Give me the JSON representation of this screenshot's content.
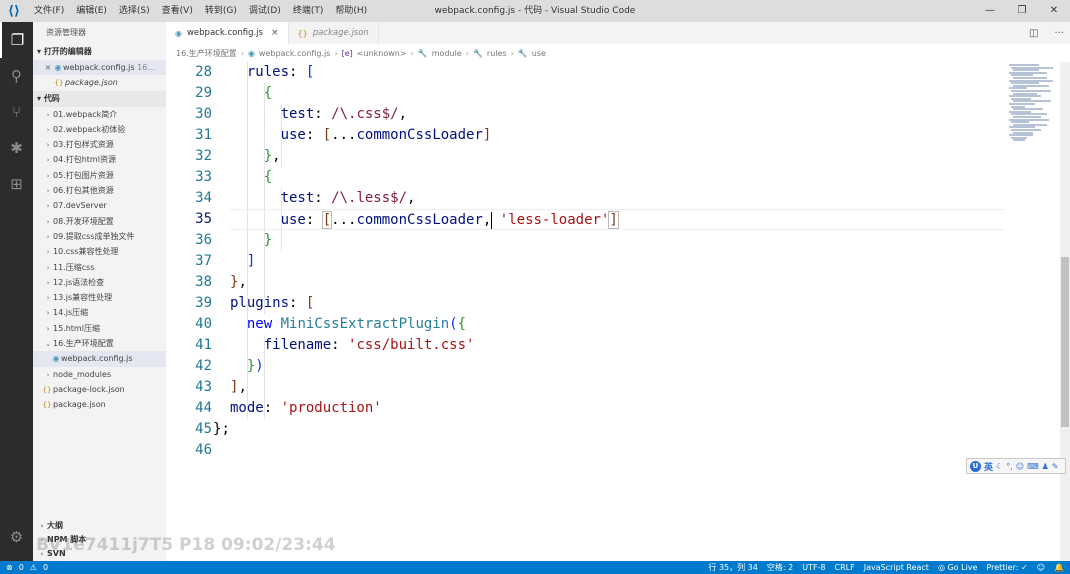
{
  "window": {
    "title": "webpack.config.js - 代码 - Visual Studio Code",
    "menu": [
      "文件(F)",
      "编辑(E)",
      "选择(S)",
      "查看(V)",
      "转到(G)",
      "调试(D)",
      "终端(T)",
      "帮助(H)"
    ]
  },
  "sidebar": {
    "title": "资源管理器",
    "open_editors_label": "打开的编辑器",
    "open_editors": [
      {
        "name": "webpack.config.js",
        "suffix": "16...",
        "icon": "js-icon",
        "selected": true
      },
      {
        "name": "package.json",
        "suffix": "",
        "icon": "json-icon",
        "selected": false
      }
    ],
    "folder_label": "代码",
    "folders": [
      "01.webpack简介",
      "02.webpack初体验",
      "03.打包样式资源",
      "04.打包html资源",
      "05.打包图片资源",
      "06.打包其他资源",
      "07.devServer",
      "08.开发环境配置",
      "09.提取css成单独文件",
      "10.css兼容性处理",
      "11.压缩css",
      "12.js语法检查",
      "13.js兼容性处理",
      "14.js压缩",
      "15.html压缩",
      "16.生产环境配置"
    ],
    "nested_file": "webpack.config.js",
    "root_files": [
      "node_modules",
      "package-lock.json",
      "package.json"
    ],
    "bottom_sections": [
      "大纲",
      "NPM 脚本",
      "SVN"
    ]
  },
  "tabs": [
    {
      "label": "webpack.config.js",
      "close": "×"
    },
    {
      "label": "package.json"
    }
  ],
  "breadcrumb": [
    "16.生产环境配置",
    "webpack.config.js",
    "<unknown>",
    "module",
    "rules",
    "use"
  ],
  "editor": {
    "line_numbers": [
      "28",
      "29",
      "30",
      "31",
      "32",
      "33",
      "34",
      "35",
      "36",
      "37",
      "38",
      "39",
      "40",
      "41",
      "42",
      "43",
      "44",
      "45",
      "46"
    ],
    "current_line": "35"
  },
  "ime": {
    "logo": "U",
    "lang": "英"
  },
  "watermark": "BV1e7411j7T5 P18 09:02/23:44",
  "status": {
    "errors": "0",
    "warnings": "0",
    "position": "行 35，列 34",
    "spaces": "空格: 2",
    "encoding": "UTF-8",
    "eol": "CRLF",
    "language": "JavaScript React",
    "golive": "Go Live",
    "prettier": "Prettier: ✓"
  }
}
